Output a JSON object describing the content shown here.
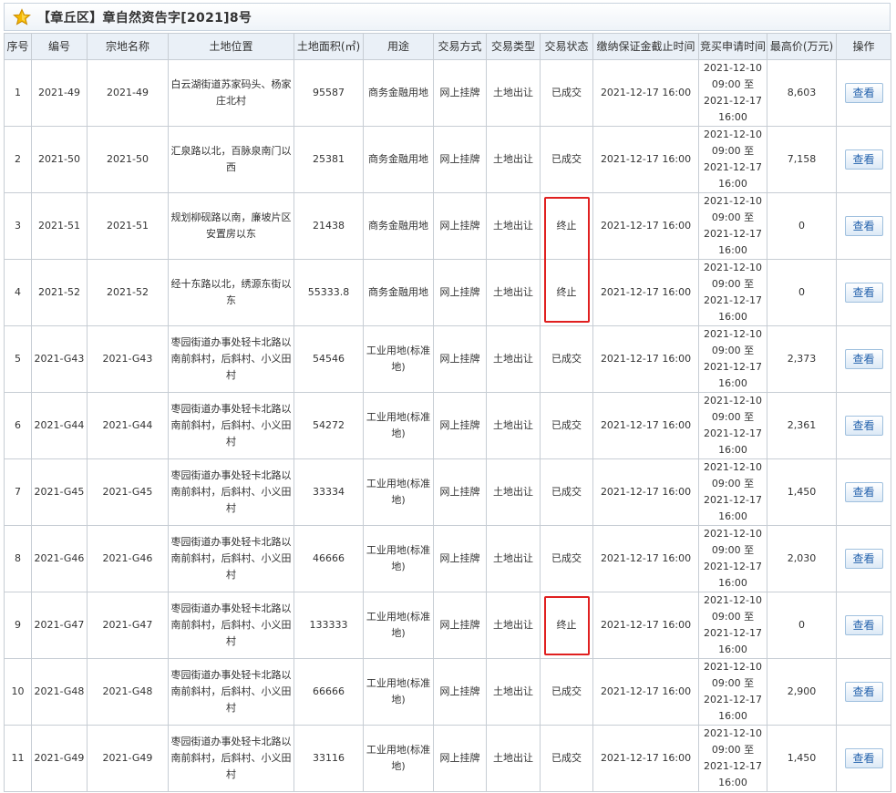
{
  "header": {
    "title": "【章丘区】章自然资告字[2021]8号",
    "icon": "star-icon",
    "star_color": "#f5b800"
  },
  "columns": [
    "序号",
    "编号",
    "宗地名称",
    "土地位置",
    "土地面积(㎡)",
    "用途",
    "交易方式",
    "交易类型",
    "交易状态",
    "缴纳保证金截止时间",
    "竞买申请时间",
    "最高价(万元)",
    "操作"
  ],
  "rows": [
    {
      "seq": "1",
      "code": "2021-49",
      "name": "2021-49",
      "location": "白云湖街道苏家码头、杨家庄北村",
      "area": "95587",
      "usage": "商务金融用地",
      "method": "网上挂牌",
      "type": "土地出让",
      "status": "已成交",
      "deposit_deadline": "2021-12-17 16:00",
      "apply_start": "2021-12-10 09:00 至",
      "apply_end": "2021-12-17 16:00",
      "max_price": "8,603",
      "action": "查看"
    },
    {
      "seq": "2",
      "code": "2021-50",
      "name": "2021-50",
      "location": "汇泉路以北，百脉泉南门以西",
      "area": "25381",
      "usage": "商务金融用地",
      "method": "网上挂牌",
      "type": "土地出让",
      "status": "已成交",
      "deposit_deadline": "2021-12-17 16:00",
      "apply_start": "2021-12-10 09:00 至",
      "apply_end": "2021-12-17 16:00",
      "max_price": "7,158",
      "action": "查看"
    },
    {
      "seq": "3",
      "code": "2021-51",
      "name": "2021-51",
      "location": "规划柳砚路以南，廉坡片区安置房以东",
      "area": "21438",
      "usage": "商务金融用地",
      "method": "网上挂牌",
      "type": "土地出让",
      "status": "终止",
      "deposit_deadline": "2021-12-17 16:00",
      "apply_start": "2021-12-10 09:00 至",
      "apply_end": "2021-12-17 16:00",
      "max_price": "0",
      "action": "查看"
    },
    {
      "seq": "4",
      "code": "2021-52",
      "name": "2021-52",
      "location": "经十东路以北，绣源东街以东",
      "area": "55333.8",
      "usage": "商务金融用地",
      "method": "网上挂牌",
      "type": "土地出让",
      "status": "终止",
      "deposit_deadline": "2021-12-17 16:00",
      "apply_start": "2021-12-10 09:00 至",
      "apply_end": "2021-12-17 16:00",
      "max_price": "0",
      "action": "查看"
    },
    {
      "seq": "5",
      "code": "2021-G43",
      "name": "2021-G43",
      "location": "枣园街道办事处轻卡北路以南前斜村，后斜村、小义田村",
      "area": "54546",
      "usage": "工业用地(标准地)",
      "method": "网上挂牌",
      "type": "土地出让",
      "status": "已成交",
      "deposit_deadline": "2021-12-17 16:00",
      "apply_start": "2021-12-10 09:00 至",
      "apply_end": "2021-12-17 16:00",
      "max_price": "2,373",
      "action": "查看"
    },
    {
      "seq": "6",
      "code": "2021-G44",
      "name": "2021-G44",
      "location": "枣园街道办事处轻卡北路以南前斜村，后斜村、小义田村",
      "area": "54272",
      "usage": "工业用地(标准地)",
      "method": "网上挂牌",
      "type": "土地出让",
      "status": "已成交",
      "deposit_deadline": "2021-12-17 16:00",
      "apply_start": "2021-12-10 09:00 至",
      "apply_end": "2021-12-17 16:00",
      "max_price": "2,361",
      "action": "查看"
    },
    {
      "seq": "7",
      "code": "2021-G45",
      "name": "2021-G45",
      "location": "枣园街道办事处轻卡北路以南前斜村，后斜村、小义田村",
      "area": "33334",
      "usage": "工业用地(标准地)",
      "method": "网上挂牌",
      "type": "土地出让",
      "status": "已成交",
      "deposit_deadline": "2021-12-17 16:00",
      "apply_start": "2021-12-10 09:00 至",
      "apply_end": "2021-12-17 16:00",
      "max_price": "1,450",
      "action": "查看"
    },
    {
      "seq": "8",
      "code": "2021-G46",
      "name": "2021-G46",
      "location": "枣园街道办事处轻卡北路以南前斜村，后斜村、小义田村",
      "area": "46666",
      "usage": "工业用地(标准地)",
      "method": "网上挂牌",
      "type": "土地出让",
      "status": "已成交",
      "deposit_deadline": "2021-12-17 16:00",
      "apply_start": "2021-12-10 09:00 至",
      "apply_end": "2021-12-17 16:00",
      "max_price": "2,030",
      "action": "查看"
    },
    {
      "seq": "9",
      "code": "2021-G47",
      "name": "2021-G47",
      "location": "枣园街道办事处轻卡北路以南前斜村，后斜村、小义田村",
      "area": "133333",
      "usage": "工业用地(标准地)",
      "method": "网上挂牌",
      "type": "土地出让",
      "status": "终止",
      "deposit_deadline": "2021-12-17 16:00",
      "apply_start": "2021-12-10 09:00 至",
      "apply_end": "2021-12-17 16:00",
      "max_price": "0",
      "action": "查看"
    },
    {
      "seq": "10",
      "code": "2021-G48",
      "name": "2021-G48",
      "location": "枣园街道办事处轻卡北路以南前斜村，后斜村、小义田村",
      "area": "66666",
      "usage": "工业用地(标准地)",
      "method": "网上挂牌",
      "type": "土地出让",
      "status": "已成交",
      "deposit_deadline": "2021-12-17 16:00",
      "apply_start": "2021-12-10 09:00 至",
      "apply_end": "2021-12-17 16:00",
      "max_price": "2,900",
      "action": "查看"
    },
    {
      "seq": "11",
      "code": "2021-G49",
      "name": "2021-G49",
      "location": "枣园街道办事处轻卡北路以南前斜村，后斜村、小义田村",
      "area": "33116",
      "usage": "工业用地(标准地)",
      "method": "网上挂牌",
      "type": "土地出让",
      "status": "已成交",
      "deposit_deadline": "2021-12-17 16:00",
      "apply_start": "2021-12-10 09:00 至",
      "apply_end": "2021-12-17 16:00",
      "max_price": "1,450",
      "action": "查看"
    }
  ],
  "highlight_color": "#e02020",
  "button_text_color": "#2563ad"
}
